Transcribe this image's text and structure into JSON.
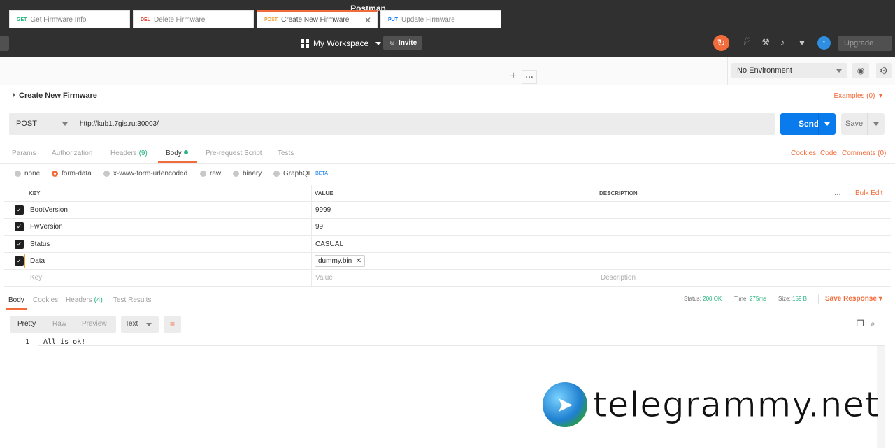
{
  "app": {
    "title": "Postman"
  },
  "topbar": {
    "workspace": "My Workspace",
    "invite": "Invite",
    "upgrade": "Upgrade"
  },
  "tabs": [
    {
      "method": "GET",
      "name": "Get Firmware Info",
      "color": "#26b47f"
    },
    {
      "method": "DEL",
      "name": "Delete Firmware",
      "color": "#e04a3a"
    },
    {
      "method": "POST",
      "name": "Create New Firmware",
      "color": "#f2a33a"
    },
    {
      "method": "PUT",
      "name": "Update Firmware",
      "color": "#097bed"
    }
  ],
  "environment": {
    "selected": "No Environment"
  },
  "request": {
    "name": "Create New Firmware",
    "examples": "Examples (0)",
    "method": "POST",
    "url": "http://kub1.7gis.ru:30003/",
    "send": "Send",
    "save": "Save"
  },
  "request_tabs": {
    "params": "Params",
    "authorization": "Authorization",
    "headers": "Headers",
    "headers_count": "(9)",
    "body": "Body",
    "prerequest": "Pre-request Script",
    "tests": "Tests",
    "cookies": "Cookies",
    "code": "Code",
    "comments": "Comments (0)"
  },
  "body_types": {
    "none": "none",
    "form_data": "form-data",
    "urlencoded": "x-www-form-urlencoded",
    "raw": "raw",
    "binary": "binary",
    "graphql": "GraphQL",
    "beta": "BETA"
  },
  "form_table": {
    "headers": {
      "key": "KEY",
      "value": "VALUE",
      "description": "DESCRIPTION",
      "bulk_edit": "Bulk Edit"
    },
    "rows": [
      {
        "key": "BootVersion",
        "value": "9999"
      },
      {
        "key": "FwVersion",
        "value": "99"
      },
      {
        "key": "Status",
        "value": "CASUAL"
      },
      {
        "key": "Data",
        "value": "dummy.bin"
      }
    ],
    "placeholders": {
      "key": "Key",
      "value": "Value",
      "description": "Description"
    }
  },
  "response": {
    "tabs": {
      "body": "Body",
      "cookies": "Cookies",
      "headers": "Headers",
      "headers_count": "(4)",
      "tests": "Test Results"
    },
    "status_label": "Status:",
    "status": "200 OK",
    "time_label": "Time:",
    "time": "275ms",
    "size_label": "Size:",
    "size": "159 B",
    "save_response": "Save Response",
    "formats": {
      "pretty": "Pretty",
      "raw": "Raw",
      "preview": "Preview",
      "text": "Text"
    },
    "line_number": "1",
    "content": "All is ok!"
  },
  "watermark": {
    "text": "telegrammy.net"
  }
}
